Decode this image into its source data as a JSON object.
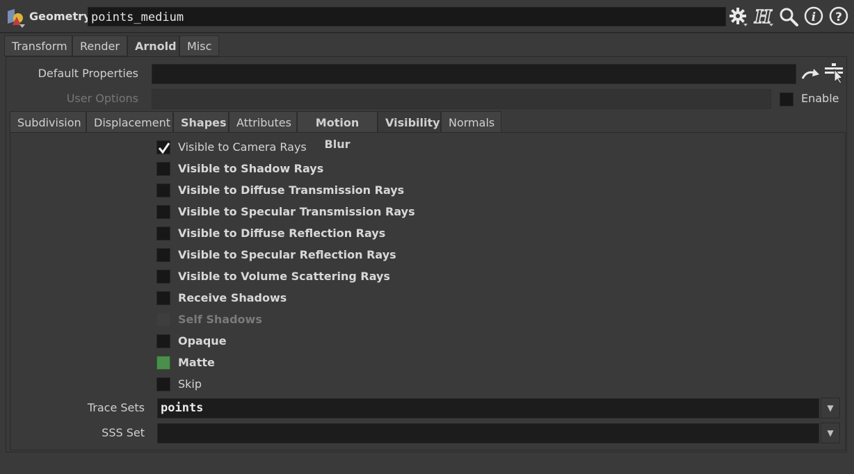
{
  "header": {
    "node_type": "Geometry",
    "node_name": "points_medium",
    "icons": [
      "node-type-icon",
      "gear-icon",
      "houdini-h-icon",
      "search-icon",
      "info-icon",
      "help-icon"
    ]
  },
  "main_tabs": [
    "Transform",
    "Render",
    "Arnold",
    "Misc"
  ],
  "active_main_tab": "Arnold",
  "default_properties": {
    "label": "Default Properties",
    "value": ""
  },
  "user_options": {
    "label": "User Options",
    "value": "",
    "enable_label": "Enable",
    "enabled": false
  },
  "sub_tabs": [
    "Subdivision",
    "Displacement",
    "Shapes",
    "Attributes",
    "Motion Blur",
    "Visibility",
    "Normals"
  ],
  "active_sub_tab": "Visibility",
  "visibility": [
    {
      "label": "Visible to Camera Rays",
      "checked": true,
      "modified": false,
      "enabled": true
    },
    {
      "label": "Visible to Shadow Rays",
      "checked": false,
      "modified": true,
      "enabled": true
    },
    {
      "label": "Visible to Diffuse Transmission Rays",
      "checked": false,
      "modified": true,
      "enabled": true
    },
    {
      "label": "Visible to Specular Transmission Rays",
      "checked": false,
      "modified": true,
      "enabled": true
    },
    {
      "label": "Visible to Diffuse Reflection Rays",
      "checked": false,
      "modified": true,
      "enabled": true
    },
    {
      "label": "Visible to Specular Reflection Rays",
      "checked": false,
      "modified": true,
      "enabled": true
    },
    {
      "label": "Visible to Volume Scattering Rays",
      "checked": false,
      "modified": true,
      "enabled": true
    },
    {
      "label": "Receive Shadows",
      "checked": false,
      "modified": true,
      "enabled": true
    },
    {
      "label": "Self Shadows",
      "checked": false,
      "modified": false,
      "enabled": false
    },
    {
      "label": "Opaque",
      "checked": false,
      "modified": true,
      "enabled": true
    },
    {
      "label": "Matte",
      "checked": true,
      "modified": true,
      "enabled": true
    },
    {
      "label": "Skip",
      "checked": false,
      "modified": false,
      "enabled": true
    }
  ],
  "trace_sets": {
    "label": "Trace Sets",
    "value": "points"
  },
  "sss_set": {
    "label": "SSS Set",
    "value": ""
  },
  "colors": {
    "background": "#3a3a3a",
    "field": "#1c1c1c",
    "matte_green": "#4a8f4a"
  }
}
